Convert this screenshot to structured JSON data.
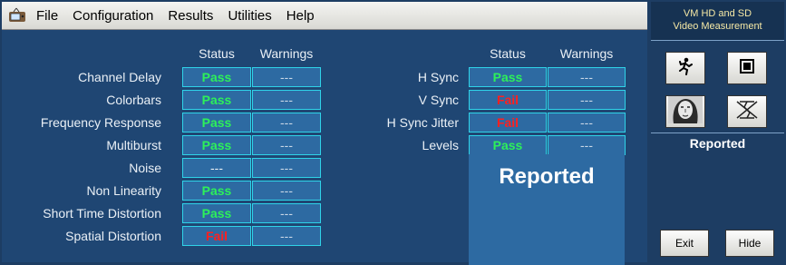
{
  "menu": [
    "File",
    "Configuration",
    "Results",
    "Utilities",
    "Help"
  ],
  "left_table": {
    "headers": {
      "status": "Status",
      "warnings": "Warnings"
    },
    "rows": [
      {
        "label": "Channel Delay",
        "status": "Pass",
        "warning": "---"
      },
      {
        "label": "Colorbars",
        "status": "Pass",
        "warning": "---"
      },
      {
        "label": "Frequency Response",
        "status": "Pass",
        "warning": "---"
      },
      {
        "label": "Multiburst",
        "status": "Pass",
        "warning": "---"
      },
      {
        "label": "Noise",
        "status": "---",
        "warning": "---"
      },
      {
        "label": "Non Linearity",
        "status": "Pass",
        "warning": "---"
      },
      {
        "label": "Short Time Distortion",
        "status": "Pass",
        "warning": "---"
      },
      {
        "label": "Spatial Distortion",
        "status": "Fail",
        "warning": "---"
      }
    ]
  },
  "right_table": {
    "headers": {
      "status": "Status",
      "warnings": "Warnings"
    },
    "rows": [
      {
        "label": "H Sync",
        "status": "Pass",
        "warning": "---"
      },
      {
        "label": "V Sync",
        "status": "Fail",
        "warning": "---"
      },
      {
        "label": "H Sync Jitter",
        "status": "Fail",
        "warning": "---"
      },
      {
        "label": "Levels",
        "status": "Pass",
        "warning": "---"
      }
    ]
  },
  "main_reported": "Reported",
  "side_panel": {
    "title_line1": "VM HD and SD",
    "title_line2": "Video Measurement",
    "reported": "Reported",
    "exit": "Exit",
    "hide": "Hide"
  },
  "colors": {
    "pass": "#2df05a",
    "fail": "#ff2020",
    "cell_bg": "#2d6aa2",
    "cell_border": "#2fd3e8"
  }
}
